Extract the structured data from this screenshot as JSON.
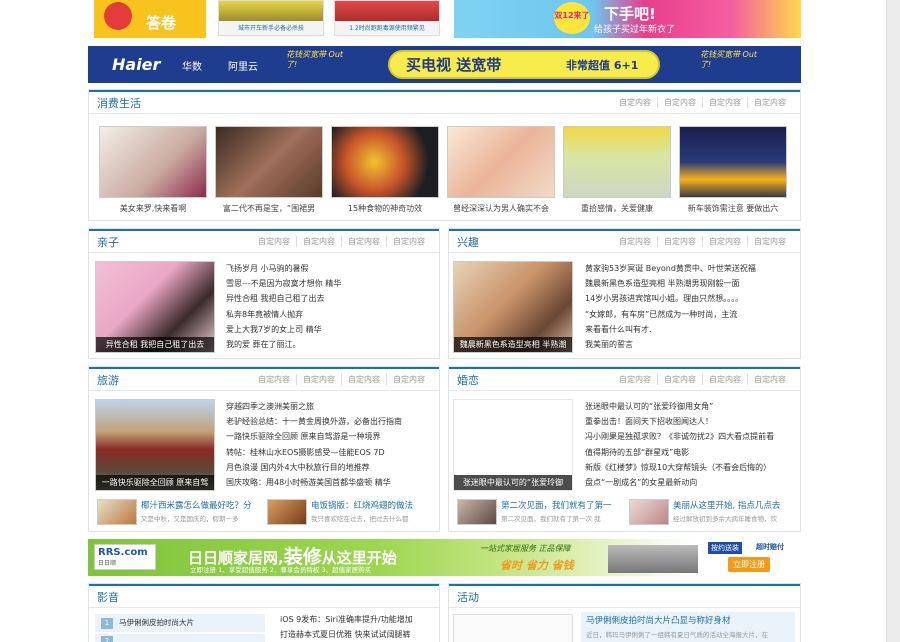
{
  "top_banners": {
    "left_text": "答卷",
    "mid1_caption": "城市开车新手必备必杀技",
    "mid2_caption": "1.2时尚跑跑毒源使用频繁见",
    "right_badge": "双12来了",
    "right_title": "下手吧!",
    "right_sub": "给孩子买过年新衣了"
  },
  "haier_ad": {
    "brand1": "Haier",
    "brand2": "华数",
    "brand3": "阿里云",
    "tag": "花钱买宽带 Out了!",
    "slogan": "买电视 送宽带",
    "deal": "非常超值 6+1"
  },
  "custom_link": "自定内容",
  "consumer": {
    "title": "消费生活",
    "items": [
      "美女来罗,快来看啊",
      "富二代不再是宝，“围裙男",
      "15种食物的神奇功效",
      "曾经深深认为男人确实不会",
      "重拾感情，关爱健康",
      "新车装饰需注意 要做出六"
    ]
  },
  "parenting": {
    "title": "亲子",
    "overlay": "异性合租 我把自己租了出去",
    "lines": [
      "飞扬岁月 小马驹的暑假",
      "雪思---不是因为寂寞才想你 精华",
      "异性合租 我把自己租了出去",
      "私奔8年竟被情人抛弃",
      "爱上大我7岁的女上司 精华",
      "我的爱 葬在了丽江。"
    ]
  },
  "interest": {
    "title": "兴趣",
    "overlay": "魏晨新黑色系造型亮相 半熟潮",
    "lines": [
      "黄家驹53岁冥诞 Beyond黄贯中、叶世荣送祝福",
      "魏晨新黑色系造型亮相 半熟潮男现刚毅一面",
      "14岁小男孩进宾馆叫小姐。理由只然想。。。。",
      "“女嫁郎，有车房”已然成为一种时尚，主流",
      "来看看什么叫有才.",
      "我美丽的誓言"
    ]
  },
  "travel": {
    "title": "旅游",
    "overlay": "一路快乐驱除全回顾 原来自驾",
    "lines": [
      "穿越四季之澳洲美丽之旅",
      "老驴经验总结：十一黄金周换外游，必备出行指南",
      "一路快乐驱除全回顾 原来自驾游是一种境界",
      "转帖：桂林山水EOS摄影感受—佳能EOS 7D",
      "月色浪漫 国内外4大中秋旅行目的地推荐",
      "国庆攻略：用48小时畅游美国首都华盛顿 精华"
    ],
    "minis": [
      {
        "a": "椰汁西米露怎么做最好吃？分",
        "b": "又是中秋，又是国庆的，假期一多"
      },
      {
        "a": "电饭锅版：红烧鸡翅的做法",
        "b": "我只喜欢吃在过去，把过去什么都"
      }
    ]
  },
  "romance": {
    "title": "婚恋",
    "overlay": "张迷眼中最认可的“张爱玲御",
    "lines": [
      "张迷眼中最认可的“张爱玲御用女角”",
      "重拳出击！面间天下招收图闻达人！",
      "冯小刚果是独孤求败？《非诚勿扰2》四大看点提前看",
      "值得期待的五部“群星戏”电影",
      "新版《红楼梦》惊现10大穿帮镜头（不看会后悔的）",
      "盘点“一剧成名”的女星最新动向"
    ],
    "minis": [
      {
        "a": "第二次见面，我们就有了第一",
        "b": "第二次见面，我们就有了第一次 我"
      },
      {
        "a": "美丽从这里开始, 指点几点去",
        "b": "经过解放初到多余大病年睡食物，饮"
      }
    ]
  },
  "rrs_ad": {
    "logo": "RRS.com",
    "logo_sub": "日日顺",
    "slogan": "日日顺家居网,",
    "slogan_big": "装修",
    "slogan_end": "从这里开始",
    "sub": "立即注册 1、享受超值服务 2、尊享会员特权 3、超值家居购买",
    "mid": "一站式家居服务 正品保障",
    "mid2": "省时 省力 省钱",
    "right1": "按约送装",
    "right2": "超时赔付",
    "cta": "立即注册"
  },
  "video": {
    "title": "影音",
    "list_item": "马伊俐俐皮拍时尚大片",
    "lines": [
      "iOS 9发布：Siri准确率提升/功能增加",
      "打造赫本式夏日优雅 快来试试阔腿裤"
    ]
  },
  "events": {
    "title": "活动",
    "headline": "马伊俐俐皮拍时尚大片凸显与称好身材",
    "desc": "近日，韩玛马伊俐俐了一组韩有夏日气质的活动全海报大片，在"
  }
}
